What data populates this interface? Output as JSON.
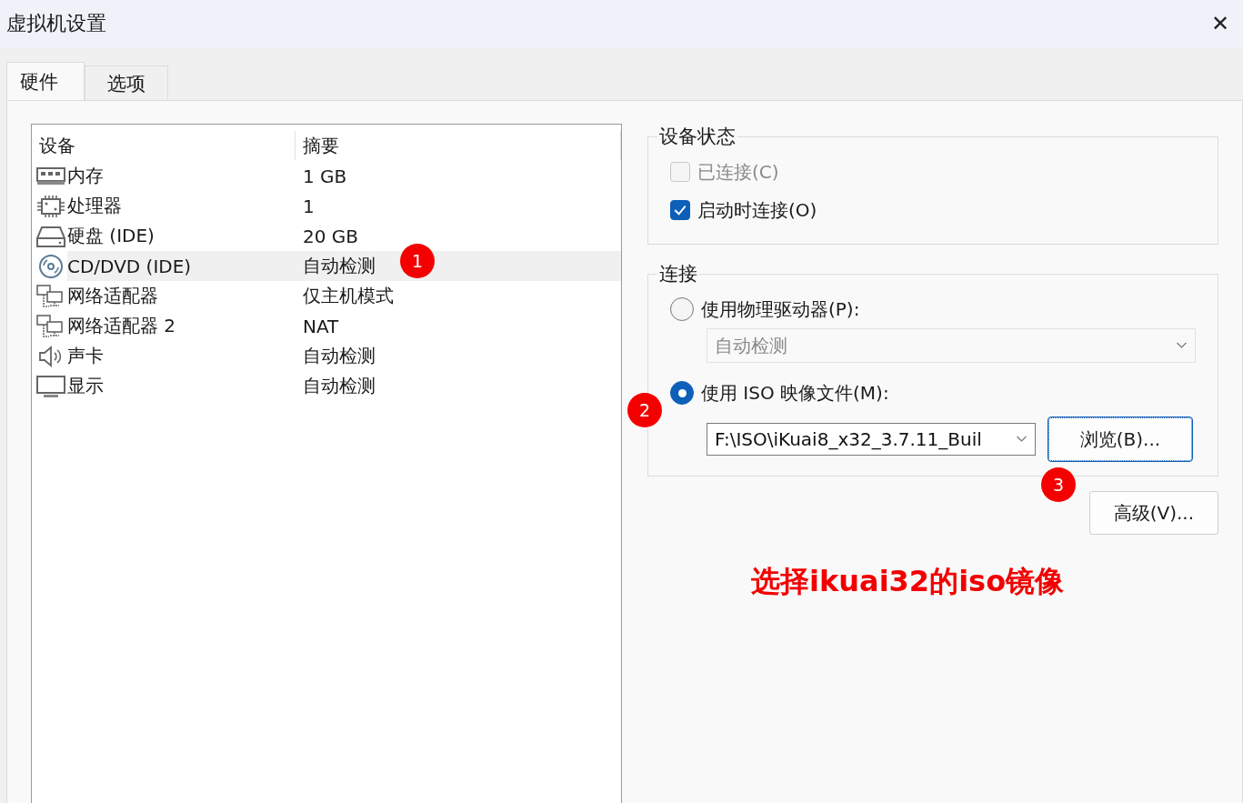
{
  "window": {
    "title": "虚拟机设置",
    "close": "✕"
  },
  "tabs": [
    {
      "label": "硬件",
      "selected": true
    },
    {
      "label": "选项",
      "selected": false
    }
  ],
  "devices": {
    "columns": [
      "设备",
      "摘要"
    ],
    "rows": [
      {
        "kind": "memory",
        "name": "内存",
        "summary": "1 GB",
        "selected": false
      },
      {
        "kind": "cpu",
        "name": "处理器",
        "summary": "1",
        "selected": false
      },
      {
        "kind": "disk",
        "name": "硬盘 (IDE)",
        "summary": "20 GB",
        "selected": false
      },
      {
        "kind": "cd",
        "name": "CD/DVD (IDE)",
        "summary": "自动检测",
        "selected": true
      },
      {
        "kind": "network",
        "name": "网络适配器",
        "summary": "仅主机模式",
        "selected": false
      },
      {
        "kind": "network",
        "name": "网络适配器 2",
        "summary": "NAT",
        "selected": false
      },
      {
        "kind": "sound",
        "name": "声卡",
        "summary": "自动检测",
        "selected": false
      },
      {
        "kind": "display",
        "name": "显示",
        "summary": "自动检测",
        "selected": false
      }
    ]
  },
  "device_status": {
    "title": "设备状态",
    "options": [
      {
        "label": "已连接(C)",
        "checked": false,
        "disabled": true
      },
      {
        "label": "启动时连接(O)",
        "checked": true,
        "disabled": false
      }
    ]
  },
  "connection": {
    "title": "连接",
    "physical": {
      "label": "使用物理驱动器(P):",
      "selected": false,
      "dropdown": "自动检测",
      "dropdown_disabled": true
    },
    "iso": {
      "label": "使用 ISO 映像文件(M):",
      "selected": true,
      "path": "F:\\ISO\\iKuai8_x32_3.7.11_Buil",
      "browse": "浏览(B)..."
    }
  },
  "advanced_button": "高级(V)...",
  "annotations": {
    "markers": [
      "1",
      "2",
      "3"
    ],
    "caption": "选择ikuai32的iso镜像"
  }
}
